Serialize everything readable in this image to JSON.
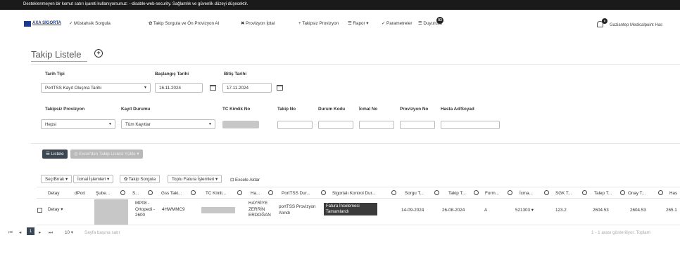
{
  "warning": "Desteklenmeyen bir komut satırı işareti kullanıyorsunuz: --disable-web-security. Sağlamlık ve güvenlik düzeyi düşecektir.",
  "nav": {
    "logo": "AXA SİGORTA",
    "items": [
      "✓ Müstahsik Sorgula",
      "✿ Takip Sorgula ve Ön Provizyon Al",
      "✖ Provizyon İptal",
      "+ Takipsiz Provizyon",
      "☰ Rapor ▾",
      "✓ Parametreler",
      "☰ Duyurular"
    ],
    "duyuru_count": "03",
    "notification_count": "0",
    "user": "Gaziantep Medicalpoint Has"
  },
  "page": {
    "title": "Takip Listele"
  },
  "filters": {
    "row1": {
      "tarih_tipi_label": "Tarih Tipi",
      "tarih_tipi_value": "PortTSS Kayıt Oluşma Tarihi",
      "baslangic_label": "Başlangıç Tarihi",
      "baslangic_value": "16.11.2024",
      "bitis_label": "Bitiş Tarihi",
      "bitis_value": "17.11.2024"
    },
    "row2": {
      "takipsiz_label": "Takipsiz Provizyon",
      "takipsiz_value": "Hepsi",
      "kayit_label": "Kayıt Durumu",
      "kayit_value": "Tüm Kayıtlar",
      "tc_label": "TC Kimlik No",
      "takip_label": "Takip No",
      "durum_label": "Durum Kodu",
      "icmal_label": "İcmal No",
      "provizyon_label": "Provizyon No",
      "hasta_label": "Hasta Ad/Soyad"
    }
  },
  "actions": {
    "listele": "☰ Listele",
    "excel_takip": "◎ Excel'den Takip Listesi Yükle ▾"
  },
  "toolbar": {
    "sec_birak": "Seç/Bırak ▾",
    "icmal": "İcmal İşlemleri ▾",
    "takip_sorgula": "✿ Takip Sorgula",
    "toplu_fatura": "Toplu Fatura İşlemleri ▾",
    "excele_aktar": "Excele Aktar"
  },
  "table": {
    "headers": [
      "Detay",
      "dPort",
      "Şube...",
      "S...",
      "Gss Taki...",
      "TC Kimli...",
      "Ha...",
      "PortTSS Dur...",
      "Sigortalı Kontrol Dur...",
      "Sorgu T...",
      "Takip T...",
      "Form...",
      "İcma...",
      "SGK T...",
      "Talep T...",
      "Onay T...",
      "Has"
    ],
    "row": {
      "detay": "Detay ▾",
      "s_col": [
        "MP08 -",
        "Ortopedi -",
        "2600"
      ],
      "gss": "4HWMMC9",
      "hasta": [
        "HAYRİYE",
        "ZERRİN",
        "ERDOĞAN"
      ],
      "porttss": [
        "portTSS Provizyon",
        "Alındı"
      ],
      "sigortali": [
        "Fatura İncelemesi",
        "Tamamlandı"
      ],
      "sorgu": "14-09-2024",
      "takip": "26-08-2024",
      "form": "A",
      "icmal": "521303 ▾",
      "sgk": "123.2",
      "talep": "2604.53",
      "onay": "2604.53",
      "has": "265.1"
    }
  },
  "pagination": {
    "first": "⏮",
    "prev": "◂",
    "current": "1",
    "next": "▸",
    "last": "⏭",
    "page_size": "10 ▾",
    "page_size_label": "Sayfa başına satır",
    "summary": "1 - 1 arası gösteriliyor. Toplam"
  }
}
